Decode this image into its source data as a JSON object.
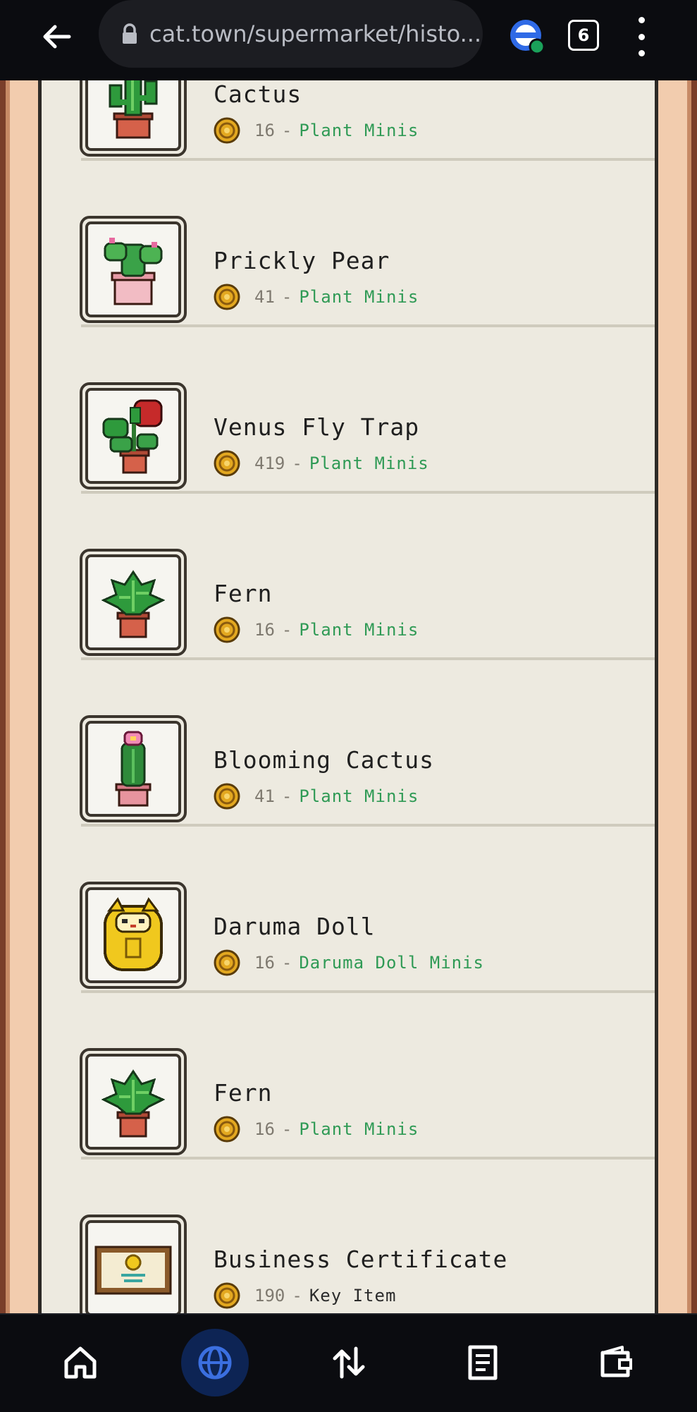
{
  "browser": {
    "url": "cat.town/supermarket/histo...",
    "tab_count": "6"
  },
  "items": [
    {
      "name": "Cactus",
      "price": "16",
      "separator": "-",
      "category": "Plant Minis",
      "icon": "cactus-icon"
    },
    {
      "name": "Prickly Pear",
      "price": "41",
      "separator": "-",
      "category": "Plant Minis",
      "icon": "prickly-pear-icon"
    },
    {
      "name": "Venus Fly Trap",
      "price": "419",
      "separator": "-",
      "category": "Plant Minis",
      "icon": "venus-fly-trap-icon"
    },
    {
      "name": "Fern",
      "price": "16",
      "separator": "-",
      "category": "Plant Minis",
      "icon": "fern-icon"
    },
    {
      "name": "Blooming Cactus",
      "price": "41",
      "separator": "-",
      "category": "Plant Minis",
      "icon": "blooming-cactus-icon"
    },
    {
      "name": "Daruma Doll",
      "price": "16",
      "separator": "-",
      "category": "Daruma Doll Minis",
      "icon": "daruma-doll-icon"
    },
    {
      "name": "Fern",
      "price": "16",
      "separator": "-",
      "category": "Plant Minis",
      "icon": "fern-icon"
    },
    {
      "name": "Business Certificate",
      "price": "190",
      "separator": "-",
      "category": "Key Item",
      "icon": "certificate-icon"
    }
  ],
  "bottom_nav": [
    {
      "icon": "home-icon"
    },
    {
      "icon": "globe-icon",
      "active": true
    },
    {
      "icon": "swap-icon"
    },
    {
      "icon": "document-icon"
    },
    {
      "icon": "wallet-icon"
    }
  ],
  "colors": {
    "category_green": "#2f9a55",
    "nav_active": "#0d2454",
    "accent_blue": "#3b6fe0"
  }
}
